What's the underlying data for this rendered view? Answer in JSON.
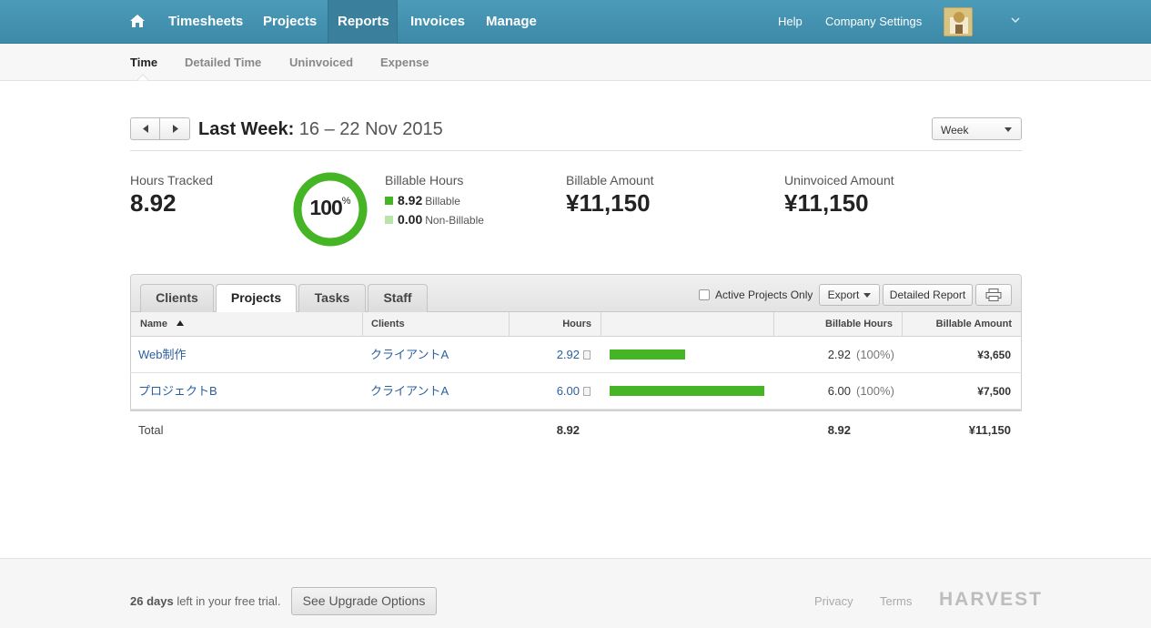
{
  "topnav": {
    "items": [
      {
        "label": "Timesheets"
      },
      {
        "label": "Projects"
      },
      {
        "label": "Reports",
        "active": true
      },
      {
        "label": "Invoices"
      },
      {
        "label": "Manage"
      }
    ],
    "help": "Help",
    "company_settings": "Company Settings",
    "icons": {
      "home": "home-icon",
      "menu": "chevron-down-icon"
    }
  },
  "subnav": {
    "items": [
      {
        "label": "Time",
        "active": true
      },
      {
        "label": "Detailed Time"
      },
      {
        "label": "Uninvoiced"
      },
      {
        "label": "Expense"
      }
    ]
  },
  "period": {
    "label": "Last Week:",
    "range": "16 – 22 Nov 2015",
    "select_value": "Week"
  },
  "stats": {
    "hours_tracked_label": "Hours Tracked",
    "hours_tracked": "8.92",
    "billable_percent": "100",
    "billable_percent_fraction": 1.0,
    "percent_sign": "%",
    "billable_hours_label": "Billable Hours",
    "billable_value": "8.92",
    "billable_text": "Billable",
    "non_billable_value": "0.00",
    "non_billable_text": "Non-Billable",
    "billable_amount_label": "Billable Amount",
    "billable_amount": "¥11,150",
    "uninvoiced_amount_label": "Uninvoiced Amount",
    "uninvoiced_amount": "¥11,150"
  },
  "colors": {
    "nav": "#3d89a8",
    "billable": "#45b526",
    "non_billable": "#b9e3a8",
    "link": "#2c5f9e"
  },
  "table": {
    "tabs": [
      {
        "label": "Clients"
      },
      {
        "label": "Projects",
        "active": true
      },
      {
        "label": "Tasks"
      },
      {
        "label": "Staff"
      }
    ],
    "active_only_label": "Active Projects Only",
    "export_label": "Export",
    "detailed_report_label": "Detailed Report",
    "print_icon": "printer-icon",
    "columns": {
      "name": "Name",
      "clients": "Clients",
      "hours": "Hours",
      "billable_hours": "Billable Hours",
      "billable_amount": "Billable Amount"
    },
    "rows": [
      {
        "name": "Web制作",
        "client": "クライアントA",
        "hours": "2.92",
        "hours_value": 2.92,
        "billable_hours": "2.92",
        "billable_pct": "(100%)",
        "amount": "¥3,650"
      },
      {
        "name": "プロジェクトB",
        "client": "クライアントA",
        "hours": "6.00",
        "hours_value": 6.0,
        "billable_hours": "6.00",
        "billable_pct": "(100%)",
        "amount": "¥7,500"
      }
    ],
    "total": {
      "label": "Total",
      "hours": "8.92",
      "billable_hours": "8.92",
      "amount": "¥11,150"
    }
  },
  "footer": {
    "trial_days": "26 days",
    "trial_text": " left in your free trial.",
    "upgrade_label": "See Upgrade Options",
    "privacy": "Privacy",
    "terms": "Terms",
    "brand": "HARVEST"
  }
}
